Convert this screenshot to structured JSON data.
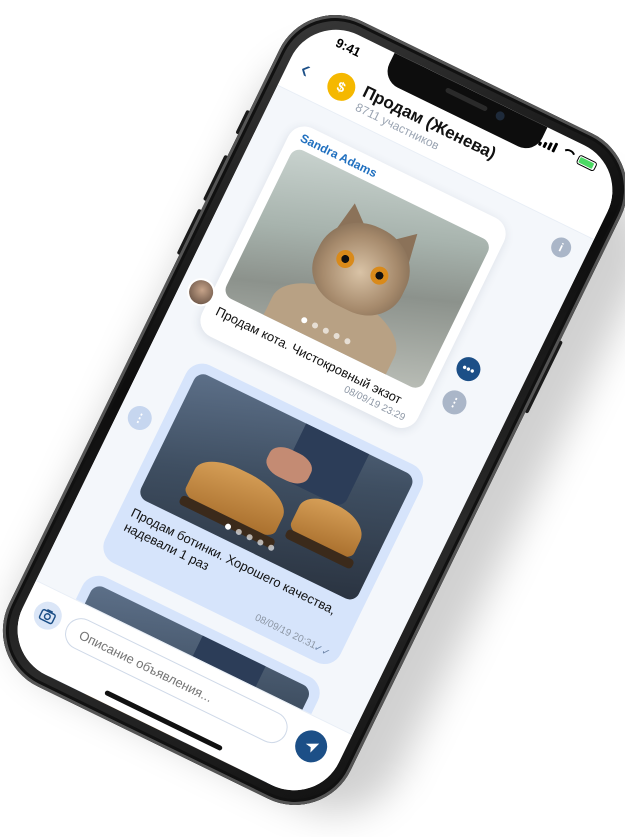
{
  "status_bar": {
    "time": "9:41"
  },
  "header": {
    "back_icon": "chevron-left-icon",
    "title": "Продам (Женева)",
    "subtitle": "8711 участников",
    "avatar_letter": "$",
    "info_label": "i"
  },
  "messages": [
    {
      "sender": "Sandra Adams",
      "text": "Продам кота. Чистокровный экзот",
      "timestamp": "08/09/19  23:29",
      "image": "cat-photo",
      "carousel_count": 5,
      "carousel_active": 0
    },
    {
      "text": "Продам ботинки. Хорошего качества, надевали 1 раз",
      "timestamp": "08/09/19  20:31",
      "image": "boots-photo",
      "carousel_count": 5,
      "carousel_active": 0,
      "read_icon": "double-check-icon"
    },
    {
      "image": "boots-photo",
      "partial": true
    }
  ],
  "composer": {
    "placeholder": "Описание объявления...",
    "camera_icon": "camera-add-icon",
    "send_icon": "send-icon"
  },
  "colors": {
    "accent": "#1c4f87",
    "sender_name": "#1f6fbf",
    "outgoing_bubble": "#d6e4fb",
    "incoming_bubble": "#ffffff",
    "channel_avatar": "#f5b800"
  }
}
